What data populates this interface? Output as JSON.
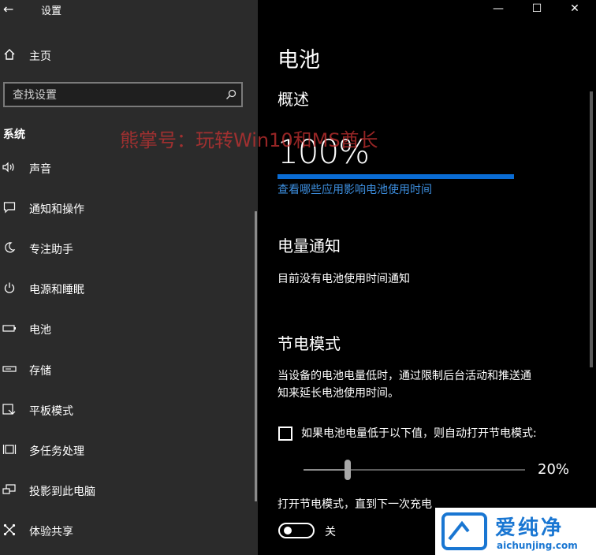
{
  "window": {
    "title": "设置",
    "back_glyph": "←",
    "min_glyph": "—",
    "max_glyph": "☐",
    "close_glyph": "✕"
  },
  "sidebar": {
    "home_label": "主页",
    "search_placeholder": "查找设置",
    "section_title": "系统",
    "items": [
      {
        "label": "声音",
        "icon": "speaker-icon"
      },
      {
        "label": "通知和操作",
        "icon": "message-icon"
      },
      {
        "label": "专注助手",
        "icon": "moon-icon"
      },
      {
        "label": "电源和睡眠",
        "icon": "power-icon"
      },
      {
        "label": "电池",
        "icon": "battery-icon"
      },
      {
        "label": "存储",
        "icon": "storage-icon"
      },
      {
        "label": "平板模式",
        "icon": "tablet-icon"
      },
      {
        "label": "多任务处理",
        "icon": "multitask-icon"
      },
      {
        "label": "投影到此电脑",
        "icon": "project-icon"
      },
      {
        "label": "体验共享",
        "icon": "share-icon"
      }
    ]
  },
  "main": {
    "title": "电池",
    "overview_heading": "概述",
    "battery_percent_text": "100%",
    "battery_level": 1.0,
    "apps_link": "查看哪些应用影响电池使用时间",
    "notification_heading": "电量通知",
    "notification_text": "目前没有电池使用时间通知",
    "saver_heading": "节电模式",
    "saver_desc_line1": "当设备的电池电量低时，通过限制后台活动和推送通",
    "saver_desc_line2": "知来延长电池使用时间。",
    "auto_checkbox_label": "如果电池电量低于以下值，则自动打开节电模式:",
    "auto_checked": false,
    "threshold_text": "20%",
    "threshold_value": 20,
    "toggle_heading": "打开节电模式，直到下一次充电",
    "toggle_state_text": "关",
    "toggle_on": false
  },
  "watermark": "熊掌号：玩转Win10和MS酋长",
  "brand": {
    "name": "爱纯净",
    "url": "aichunjing.com",
    "color": "#1976d2"
  },
  "colors": {
    "sidebar_bg": "#2b2b2b",
    "content_bg": "#000000",
    "accent": "#0a6cd4",
    "link": "#3d8fe0"
  }
}
